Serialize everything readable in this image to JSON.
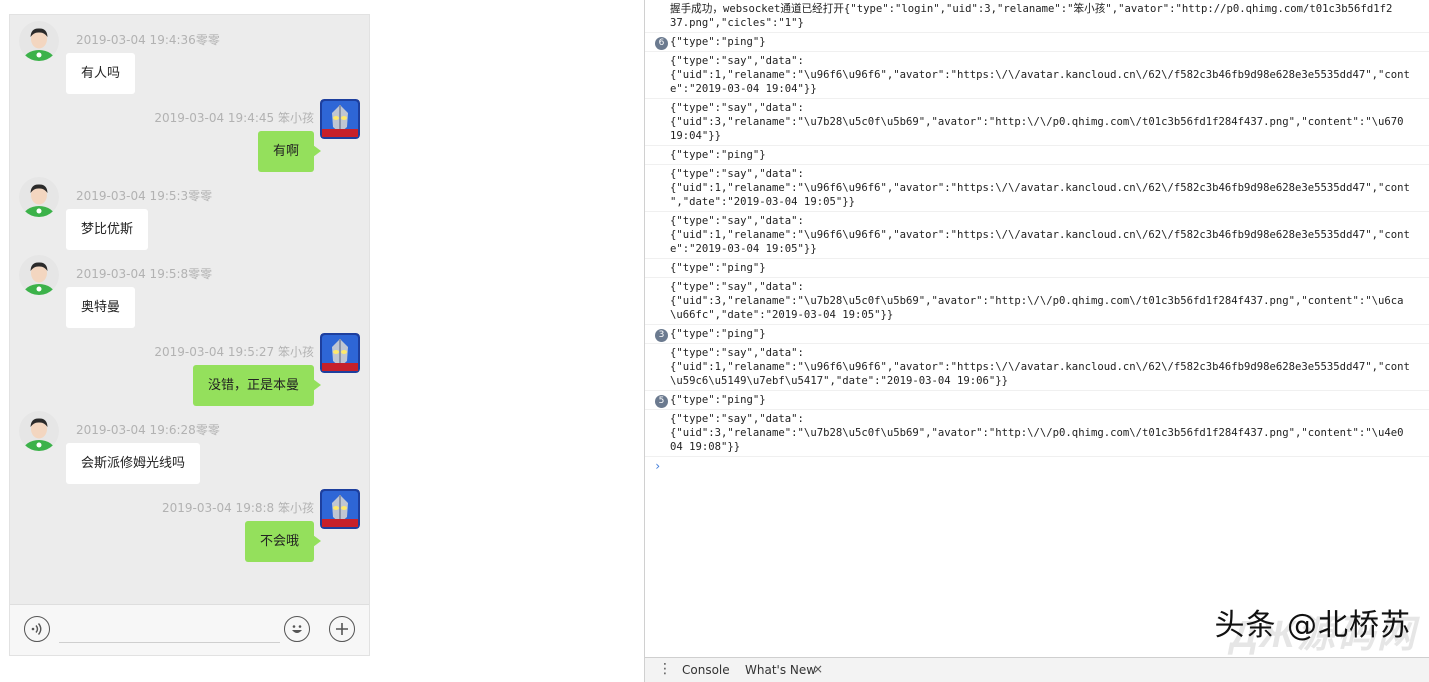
{
  "chat": {
    "messages": [
      {
        "side": "left",
        "meta": "2019-03-04 19:4:36零零",
        "text": "有人吗"
      },
      {
        "side": "right",
        "meta": "2019-03-04 19:4:45   笨小孩",
        "text": "有啊"
      },
      {
        "side": "left",
        "meta": "2019-03-04 19:5:3零零",
        "text": "梦比优斯"
      },
      {
        "side": "left",
        "meta": "2019-03-04 19:5:8零零",
        "text": "奥特曼"
      },
      {
        "side": "right",
        "meta": "2019-03-04 19:5:27   笨小孩",
        "text": "没错，正是本曼"
      },
      {
        "side": "left",
        "meta": "2019-03-04 19:6:28零零",
        "text": "会斯派修姆光线吗"
      },
      {
        "side": "right",
        "meta": "2019-03-04 19:8:8   笨小孩",
        "text": "不会哦"
      }
    ],
    "input": {
      "placeholder": "",
      "voice_icon": "voice-icon",
      "emoji_icon": "emoji-icon",
      "add_icon": "plus-icon"
    }
  },
  "console": {
    "rows": [
      {
        "count": "",
        "text": "握手成功，websocket通道已经打开{\"type\":\"login\",\"uid\":3,\"relaname\":\"笨小孩\",\"avator\":\"http://p0.qhimg.com/t01c3b56fd1f2\n37.png\",\"cicles\":\"1\"}"
      },
      {
        "count": "6",
        "text": "{\"type\":\"ping\"}"
      },
      {
        "count": "",
        "text": "{\"type\":\"say\",\"data\":\n{\"uid\":1,\"relaname\":\"\\u96f6\\u96f6\",\"avator\":\"https:\\/\\/avatar.kancloud.cn\\/62\\/f582c3b46fb9d98e628e3e5535dd47\",\"cont\ne\":\"2019-03-04 19:04\"}}"
      },
      {
        "count": "",
        "text": "{\"type\":\"say\",\"data\":\n{\"uid\":3,\"relaname\":\"\\u7b28\\u5c0f\\u5b69\",\"avator\":\"http:\\/\\/p0.qhimg.com\\/t01c3b56fd1f284f437.png\",\"content\":\"\\u670\n19:04\"}}"
      },
      {
        "count": "",
        "text": "{\"type\":\"ping\"}"
      },
      {
        "count": "",
        "text": "{\"type\":\"say\",\"data\":\n{\"uid\":1,\"relaname\":\"\\u96f6\\u96f6\",\"avator\":\"https:\\/\\/avatar.kancloud.cn\\/62\\/f582c3b46fb9d98e628e3e5535dd47\",\"cont\n\",\"date\":\"2019-03-04 19:05\"}}"
      },
      {
        "count": "",
        "text": "{\"type\":\"say\",\"data\":\n{\"uid\":1,\"relaname\":\"\\u96f6\\u96f6\",\"avator\":\"https:\\/\\/avatar.kancloud.cn\\/62\\/f582c3b46fb9d98e628e3e5535dd47\",\"cont\ne\":\"2019-03-04 19:05\"}}"
      },
      {
        "count": "",
        "text": "{\"type\":\"ping\"}"
      },
      {
        "count": "",
        "text": "{\"type\":\"say\",\"data\":\n{\"uid\":3,\"relaname\":\"\\u7b28\\u5c0f\\u5b69\",\"avator\":\"http:\\/\\/p0.qhimg.com\\/t01c3b56fd1f284f437.png\",\"content\":\"\\u6ca\n\\u66fc\",\"date\":\"2019-03-04 19:05\"}}"
      },
      {
        "count": "3",
        "text": "{\"type\":\"ping\"}"
      },
      {
        "count": "",
        "text": "{\"type\":\"say\",\"data\":\n{\"uid\":1,\"relaname\":\"\\u96f6\\u96f6\",\"avator\":\"https:\\/\\/avatar.kancloud.cn\\/62\\/f582c3b46fb9d98e628e3e5535dd47\",\"cont\n\\u59c6\\u5149\\u7ebf\\u5417\",\"date\":\"2019-03-04 19:06\"}}"
      },
      {
        "count": "5",
        "text": "{\"type\":\"ping\"}"
      },
      {
        "count": "",
        "text": "{\"type\":\"say\",\"data\":\n{\"uid\":3,\"relaname\":\"\\u7b28\\u5c0f\\u5b69\",\"avator\":\"http:\\/\\/p0.qhimg.com\\/t01c3b56fd1f284f437.png\",\"content\":\"\\u4e0\n04 19:08\"}}"
      }
    ],
    "prompt": "›"
  },
  "drawer": {
    "tab_console": "Console",
    "tab_whats_new": "What's New",
    "close": "×"
  },
  "watermark": {
    "text": "头条 @北桥苏",
    "bg_text": "ДЖ源码网"
  },
  "colors": {
    "green_bubble": "#94e05c",
    "chat_bg": "#ececec"
  }
}
